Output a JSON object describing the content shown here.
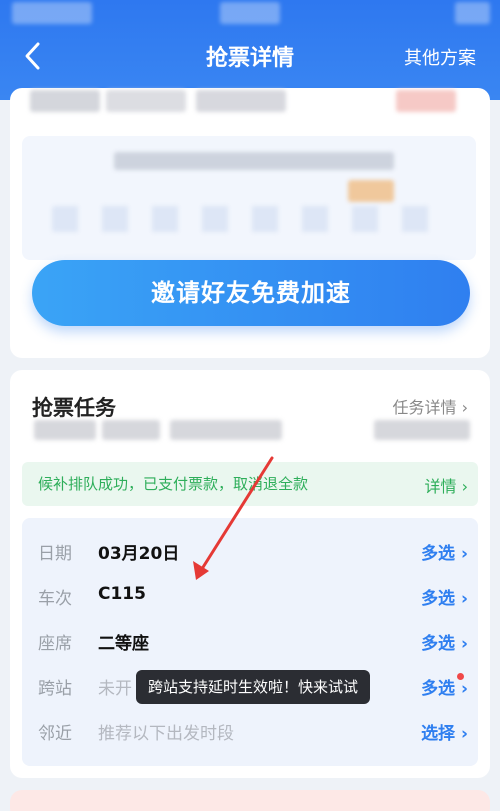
{
  "header": {
    "title": "抢票详情",
    "right_action": "其他方案",
    "back_icon": "chevron-left-icon"
  },
  "card_top": {
    "invite_button": "邀请好友免费加速"
  },
  "task_card": {
    "title": "抢票任务",
    "detail_link": "任务详情 ›",
    "notice": {
      "text": "候补排队成功，已支付票款，取消退全款",
      "link": "详情 ›"
    },
    "options": [
      {
        "label": "日期",
        "value": "03月20日",
        "action": "多选 ›",
        "muted": false
      },
      {
        "label": "车次",
        "value": "C115",
        "action": "多选 ›",
        "muted": false
      },
      {
        "label": "座席",
        "value": "二等座",
        "action": "多选 ›",
        "muted": false
      },
      {
        "label": "跨站",
        "value": "未开",
        "action": "多选 ›",
        "muted": true
      },
      {
        "label": "邻近",
        "value": "推荐以下出发时段",
        "action": "选择 ›",
        "muted": true
      }
    ],
    "tooltip": "跨站支持延时生效啦！快来试试"
  },
  "colors": {
    "header_blue": "#2e78f0",
    "action_blue": "#2f7ff0",
    "notice_green": "#2eae5a",
    "annotation_red": "#e53935"
  }
}
